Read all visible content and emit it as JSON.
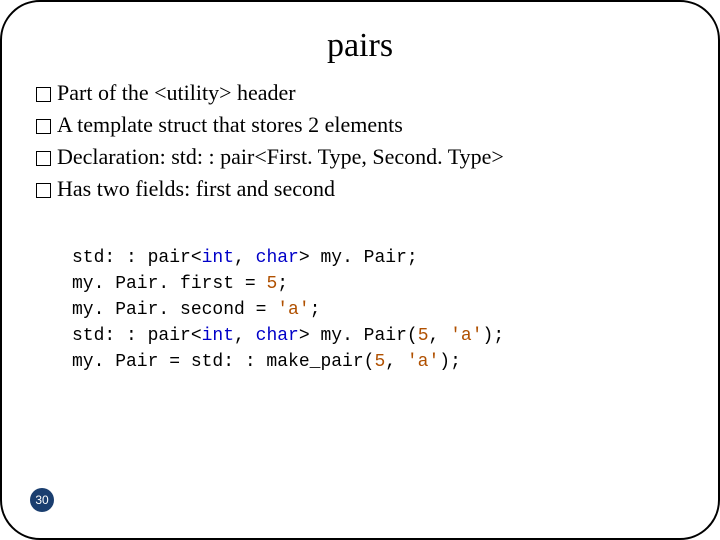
{
  "title": "pairs",
  "bullets": [
    "Part of the <utility> header",
    "A template struct that stores 2 elements",
    "Declaration: std: : pair<First. Type, Second. Type>",
    "Has two fields: first and second"
  ],
  "code": {
    "l1a": "std: : pair<",
    "l1b": "int",
    "l1c": ", ",
    "l1d": "char",
    "l1e": "> my. Pair;",
    "l2a": "my. Pair. first = ",
    "l2b": "5",
    "l2c": ";",
    "l3a": "my. Pair. second = ",
    "l3b": "'a'",
    "l3c": ";",
    "l4a": "std: : pair<",
    "l4b": "int",
    "l4c": ", ",
    "l4d": "char",
    "l4e": "> my. Pair(",
    "l4f": "5",
    "l4g": ", ",
    "l4h": "'a'",
    "l4i": ");",
    "l5a": "my. Pair = std: : make_pair(",
    "l5b": "5",
    "l5c": ", ",
    "l5d": "'a'",
    "l5e": ");"
  },
  "page_number": "30"
}
